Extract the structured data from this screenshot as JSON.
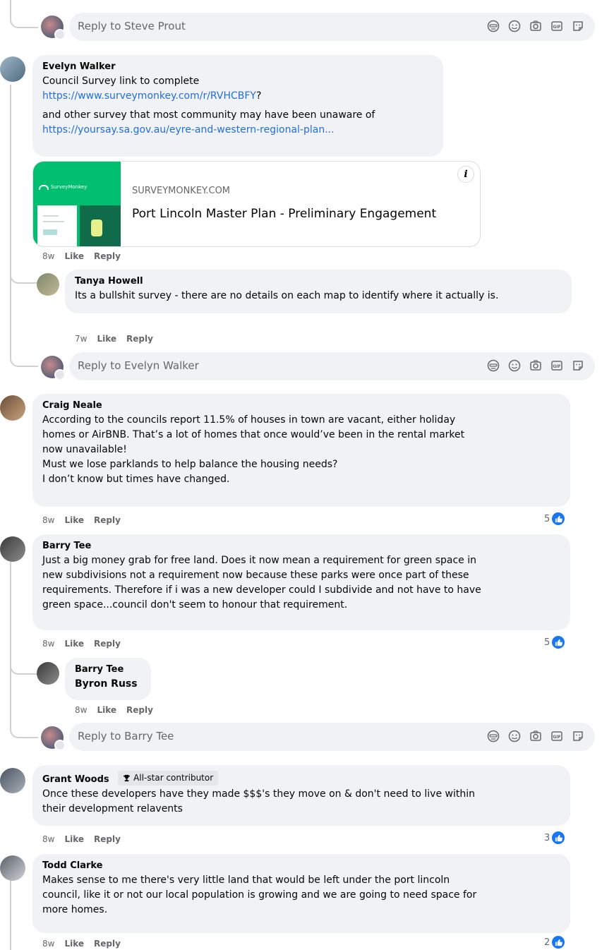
{
  "reply_boxes": [
    {
      "placeholder": "Reply to Steve Prout"
    },
    {
      "placeholder": "Reply to Evelyn Walker"
    },
    {
      "placeholder": "Reply to Barry Tee"
    }
  ],
  "reply_icons": [
    "avatar-sticker-icon",
    "emoji-icon",
    "camera-icon",
    "gif-icon",
    "sticker-icon"
  ],
  "comments": {
    "evelyn": {
      "author": "Evelyn Walker",
      "text1": "Council Survey link to complete",
      "link1": "https://www.surveymonkey.com/r/RVHCBFY",
      "link1_suffix": "?",
      "text2": "and other survey that most community may have been unaware of",
      "link2": "https://yoursay.sa.gov.au/eyre-and-western-regional-plan...",
      "time": "8w",
      "like": "Like",
      "reply": "Reply",
      "card": {
        "logo_text": "SurveyMonkey",
        "domain": "SURVEYMONKEY.COM",
        "title": "Port Lincoln Master Plan - Preliminary Engagement",
        "info": "i"
      }
    },
    "tanya": {
      "author": "Tanya Howell",
      "text": "Its a bullshit survey - there are no details on each map to identify where it actually is.",
      "time": "7w",
      "like": "Like",
      "reply": "Reply"
    },
    "craig": {
      "author": "Craig Neale",
      "lines": [
        "According to the councils report 11.5% of houses in town are vacant, either holiday",
        "homes or AirBNB. That’s a lot of homes that once would’ve been in the rental market",
        "now unavailable!",
        "Must we lose parklands to help balance the housing needs?",
        "I don’t know but times have changed."
      ],
      "time": "8w",
      "like": "Like",
      "reply": "Reply",
      "reactions": "5"
    },
    "barry": {
      "author": "Barry Tee",
      "lines": [
        "Just a big money grab for free land. Does it now mean a requirement for green space in",
        "new subdivisions not a requirement now because these parks were once part of these",
        "requirements. Therefore if i was a new developer could I subdivide and not have to have",
        "green space...council don't seem to honour that requirement."
      ],
      "time": "8w",
      "like": "Like",
      "reply": "Reply",
      "reactions": "5"
    },
    "barry_reply": {
      "author": "Barry Tee",
      "mention": "Byron Russ",
      "time": "8w",
      "like": "Like",
      "reply": "Reply"
    },
    "grant": {
      "author": "Grant Woods",
      "badge": "All-star contributor",
      "lines": [
        "Once these developers have they made $$$'s they move on & don't need to live within",
        "their development relavents"
      ],
      "time": "8w",
      "like": "Like",
      "reply": "Reply",
      "reactions": "3"
    },
    "todd": {
      "author": "Todd Clarke",
      "lines": [
        "Makes sense to me there's very little land that would be left under the port lincoln",
        "council, like it or not our local population is growing and we are going to need space for",
        "more homes."
      ],
      "time": "8w",
      "like": "Like",
      "reply": "Reply",
      "reactions": "2"
    }
  },
  "colors": {
    "bubble": "#f0f2f5",
    "link": "#216fdb",
    "meta": "#65676b",
    "like_blue": "#1877f2",
    "surveymonkey_green": "#00bf6f"
  }
}
